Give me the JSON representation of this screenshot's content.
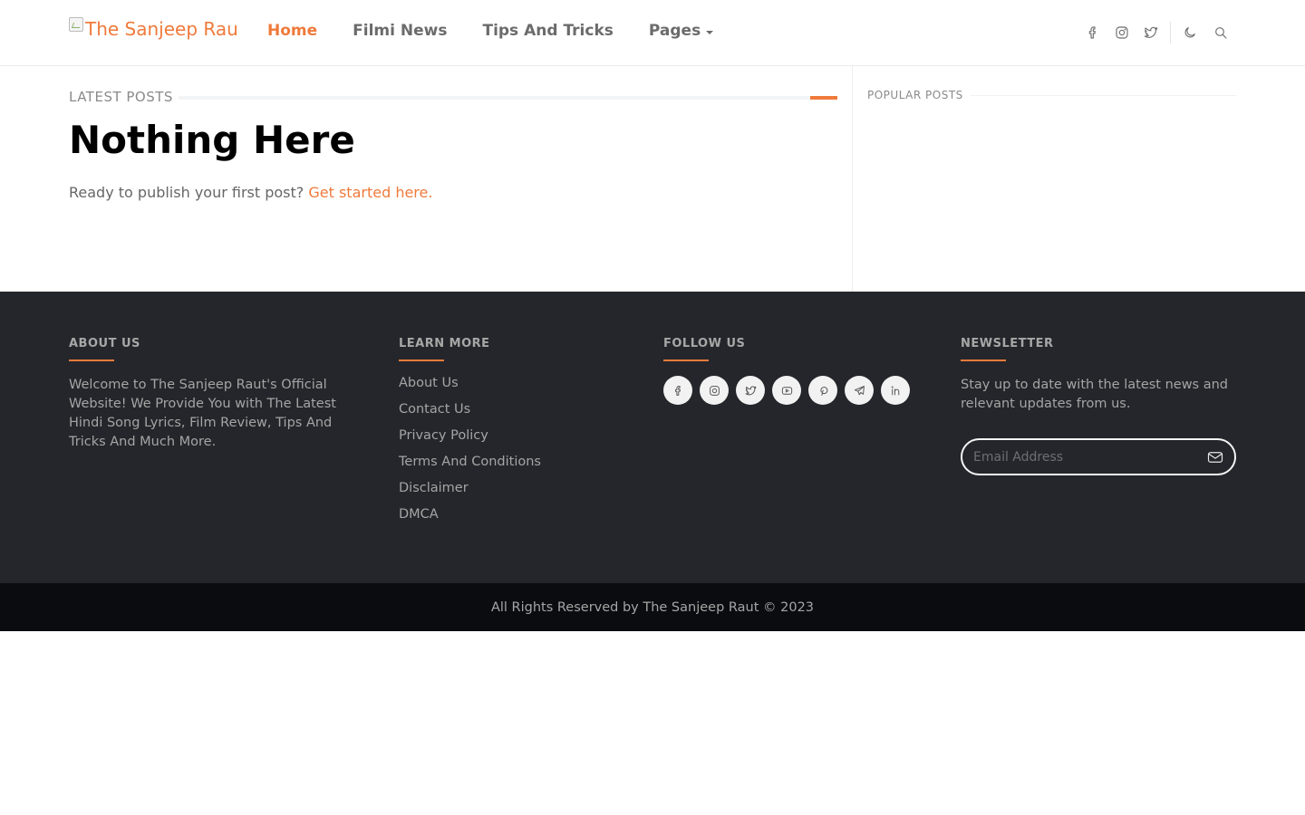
{
  "header": {
    "logo_alt": "The Sanjeep Rau",
    "nav": [
      {
        "label": "Home"
      },
      {
        "label": "Filmi News"
      },
      {
        "label": "Tips And Tricks"
      },
      {
        "label": "Pages"
      }
    ],
    "icons": [
      "facebook-icon",
      "instagram-icon",
      "twitter-icon",
      "moon-icon",
      "search-icon"
    ]
  },
  "main": {
    "section_label": "LATEST POSTS",
    "title": "Nothing Here",
    "intro_text": "Ready to publish your first post? ",
    "intro_link": "Get started here."
  },
  "sidebar": {
    "popular_label": "POPULAR POSTS"
  },
  "footer": {
    "about": {
      "heading": "ABOUT US",
      "text": "Welcome to The Sanjeep Raut's Official Website! We Provide You with The Latest Hindi Song Lyrics, Film Review, Tips And Tricks And Much More."
    },
    "learn": {
      "heading": "LEARN MORE",
      "links": [
        "About Us",
        "Contact Us",
        "Privacy Policy",
        "Terms And Conditions",
        "Disclaimer",
        "DMCA"
      ]
    },
    "follow": {
      "heading": "FOLLOW US",
      "socials": [
        "facebook-icon",
        "instagram-icon",
        "twitter-icon",
        "youtube-icon",
        "pinterest-icon",
        "telegram-icon",
        "linkedin-icon"
      ]
    },
    "newsletter": {
      "heading": "NEWSLETTER",
      "text": "Stay up to date with the latest news and relevant updates from us.",
      "placeholder": "Email Address"
    },
    "copyright": "All Rights Reserved by The Sanjeep Raut © 2023"
  },
  "colors": {
    "accent": "#ef7a3b",
    "footer_bg": "#24262b",
    "copyright_bg": "#0b0c10"
  }
}
